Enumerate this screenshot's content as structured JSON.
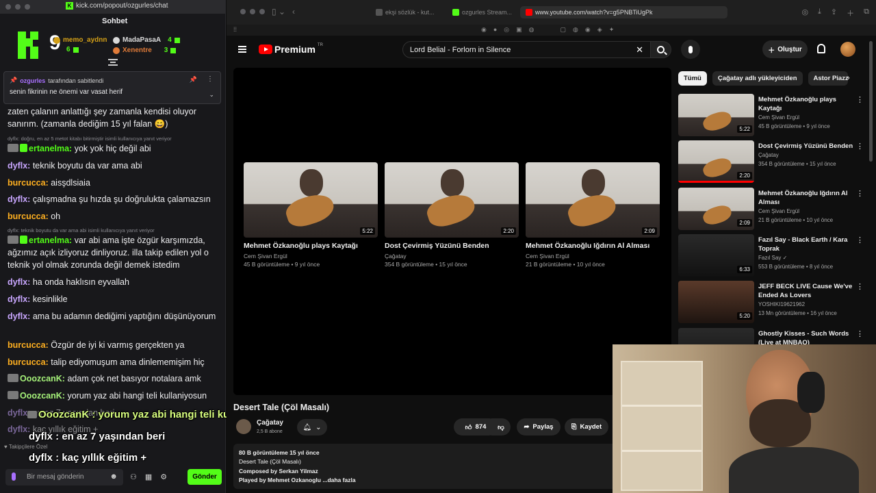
{
  "kick": {
    "url": "kick.com/popout/ozgurles/chat",
    "chat_title": "Sohbet",
    "viewer_big": "9",
    "leaderboard": [
      {
        "name": "memo_aydnn",
        "count": "6"
      },
      {
        "name": "MadaPasaA",
        "count": "4"
      },
      {
        "name": "Xenentre",
        "count": "3"
      }
    ],
    "pinned": {
      "by_user": "ozgurles",
      "by_suffix": "tarafından sabitlendi",
      "text": "senin fikrinin ne önemi var vasat herif"
    },
    "messages": [
      {
        "user": "",
        "text": "zaten çalanın anlattığı şey zamanla kendisi oluyor sanırım. (zamanla dediğim 15 yıl falan 😄)"
      },
      {
        "reply": "dyflx: doğru, en az 5 metot kitabı bitirmiştir isimli kullanıcıya yanıt veriyor"
      },
      {
        "user": "ertanelma:",
        "text": "yok yok hiç değil abi"
      },
      {
        "user": "dyflx:",
        "text": "teknik boyutu da var ama abi"
      },
      {
        "user": "burcucca:",
        "text": "aisşdlsiaia"
      },
      {
        "user": "dyflx:",
        "text": "çalışmadna şu hızda şu doğrulukta çalamazsın"
      },
      {
        "user": "burcucca:",
        "text": "oh"
      },
      {
        "reply": "dyflx: teknik boyutu da var ama abi isimli kullanıcıya yanıt veriyor"
      },
      {
        "user": "ertanelma:",
        "text": "var abi ama işte özgür karşımızda, ağzımız açık izliyoruz dinliyoruz. illa takip edilen yol o teknik yol olmak zorunda değil demek istedim"
      },
      {
        "user": "dyflx:",
        "text": "ha onda haklısın eyvallah"
      },
      {
        "user": "dyflx:",
        "text": "kesinlikle"
      },
      {
        "user": "dyflx:",
        "text": "ama bu adamın dediğimi yaptığını düşünüyorum"
      },
      {
        "user": "burcucca:",
        "text": "Özgür de iyi ki varmış gerçekten ya"
      },
      {
        "user": "burcucca:",
        "text": "talip ediyomuşum ama dinlememişim hiç"
      },
      {
        "user": "OoozcanK:",
        "text": "adam çok net basıyor notalara amk"
      },
      {
        "user": "OoozcanK:",
        "text": "yorum yaz abi hangi teli kullaniyosun"
      },
      {
        "user": "dyflx:",
        "text": "en az 7 yaşından beri"
      },
      {
        "user": "dyflx:",
        "text": "kaç yıllık eğitim +"
      }
    ],
    "overlay": [
      "OoozcanK : yorum yaz abi hangi teli kullaniyosun",
      "dyflx : en az 7 yaşından beri",
      "dyflx : kaç yıllık eğitim +"
    ],
    "followers_only": "Takipçilere Özel",
    "input_placeholder": "Bir mesaj gönderin",
    "send_label": "Gönder"
  },
  "browser": {
    "tabs": [
      "ekşi sözlük - kut...",
      "ozgurles Stream...",
      "www.youtube.com/watch?v=g5PNBTiUgPk"
    ]
  },
  "youtube": {
    "logo_text": "Premium",
    "logo_region": "TR",
    "search_value": "Lord Belial - Forlorn in Silence",
    "create_label": "Oluştur",
    "end_cards": [
      {
        "title": "Mehmet Özkanoğlu plays Kaytağı",
        "channel": "Cem Şivan Ergül",
        "meta": "45 B görüntüleme • 9 yıl önce",
        "duration": "5:22"
      },
      {
        "title": "Dost Çevirmiş Yüzünü Benden",
        "channel": "Çağatay",
        "meta": "354 B görüntüleme • 15 yıl önce",
        "duration": "2:20"
      },
      {
        "title": "Mehmet Özkanoğlu Iğdırın Al Alması",
        "channel": "Cem Şivan Ergül",
        "meta": "21 B görüntüleme • 10 yıl önce",
        "duration": "2:09"
      }
    ],
    "video_title": "Desert Tale (Çöl Masalı)",
    "channel_name": "Çağatay",
    "channel_subs": "2,5 B abone",
    "likes": "874",
    "share_label": "Paylaş",
    "save_label": "Kaydet",
    "description": {
      "meta": "80 B görüntüleme  15 yıl önce",
      "line1": "Desert Tale (Çöl Masalı)",
      "line2": "Composed by Serkan Yilmaz",
      "line3": "Played by Mehmet Ozkanoglu",
      "more": "...daha fazla"
    },
    "chips": [
      "Tümü",
      "Çağatay adlı yükleyiciden",
      "Astor Piazzo"
    ],
    "recommendations": [
      {
        "title": "Mehmet Özkanoğlu plays Kaytağı",
        "channel": "Cem Şivan Ergül",
        "meta": "45 B görüntüleme • 9 yıl önce",
        "duration": "5:22",
        "progress": 0
      },
      {
        "title": "Dost Çevirmiş Yüzünü Benden",
        "channel": "Çağatay",
        "meta": "354 B görüntüleme • 15 yıl önce",
        "duration": "2:20",
        "progress": 1
      },
      {
        "title": "Mehmet Özkanoğlu Iğdırın Al Alması",
        "channel": "Cem Şivan Ergül",
        "meta": "21 B görüntüleme • 10 yıl önce",
        "duration": "2:09",
        "progress": 0
      },
      {
        "title": "Fazıl Say - Black Earth / Kara Toprak",
        "channel": "Fazıl Say",
        "meta": "553 B görüntüleme • 8 yıl önce",
        "duration": "6:33",
        "progress": 0
      },
      {
        "title": "JEFF BECK LIVE Cause We've Ended As Lovers",
        "channel": "YOSHIKI19621962",
        "meta": "13 Mn görüntüleme • 16 yıl önce",
        "duration": "5:20",
        "progress": 0
      },
      {
        "title": "Ghostly Kisses - Such Words (Live at MNBAQ)",
        "channel": "",
        "meta": "",
        "duration": "",
        "progress": 0
      }
    ]
  }
}
